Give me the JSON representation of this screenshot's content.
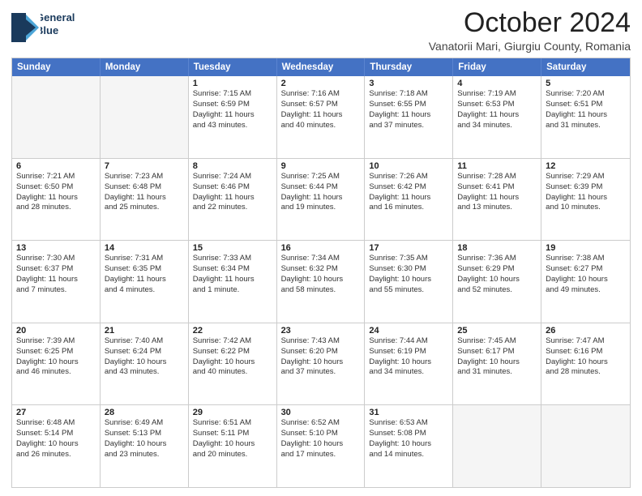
{
  "header": {
    "logo_line1": "General",
    "logo_line2": "Blue",
    "month": "October 2024",
    "location": "Vanatorii Mari, Giurgiu County, Romania"
  },
  "days_of_week": [
    "Sunday",
    "Monday",
    "Tuesday",
    "Wednesday",
    "Thursday",
    "Friday",
    "Saturday"
  ],
  "weeks": [
    [
      {
        "day": "",
        "lines": []
      },
      {
        "day": "",
        "lines": []
      },
      {
        "day": "1",
        "lines": [
          "Sunrise: 7:15 AM",
          "Sunset: 6:59 PM",
          "Daylight: 11 hours",
          "and 43 minutes."
        ]
      },
      {
        "day": "2",
        "lines": [
          "Sunrise: 7:16 AM",
          "Sunset: 6:57 PM",
          "Daylight: 11 hours",
          "and 40 minutes."
        ]
      },
      {
        "day": "3",
        "lines": [
          "Sunrise: 7:18 AM",
          "Sunset: 6:55 PM",
          "Daylight: 11 hours",
          "and 37 minutes."
        ]
      },
      {
        "day": "4",
        "lines": [
          "Sunrise: 7:19 AM",
          "Sunset: 6:53 PM",
          "Daylight: 11 hours",
          "and 34 minutes."
        ]
      },
      {
        "day": "5",
        "lines": [
          "Sunrise: 7:20 AM",
          "Sunset: 6:51 PM",
          "Daylight: 11 hours",
          "and 31 minutes."
        ]
      }
    ],
    [
      {
        "day": "6",
        "lines": [
          "Sunrise: 7:21 AM",
          "Sunset: 6:50 PM",
          "Daylight: 11 hours",
          "and 28 minutes."
        ]
      },
      {
        "day": "7",
        "lines": [
          "Sunrise: 7:23 AM",
          "Sunset: 6:48 PM",
          "Daylight: 11 hours",
          "and 25 minutes."
        ]
      },
      {
        "day": "8",
        "lines": [
          "Sunrise: 7:24 AM",
          "Sunset: 6:46 PM",
          "Daylight: 11 hours",
          "and 22 minutes."
        ]
      },
      {
        "day": "9",
        "lines": [
          "Sunrise: 7:25 AM",
          "Sunset: 6:44 PM",
          "Daylight: 11 hours",
          "and 19 minutes."
        ]
      },
      {
        "day": "10",
        "lines": [
          "Sunrise: 7:26 AM",
          "Sunset: 6:42 PM",
          "Daylight: 11 hours",
          "and 16 minutes."
        ]
      },
      {
        "day": "11",
        "lines": [
          "Sunrise: 7:28 AM",
          "Sunset: 6:41 PM",
          "Daylight: 11 hours",
          "and 13 minutes."
        ]
      },
      {
        "day": "12",
        "lines": [
          "Sunrise: 7:29 AM",
          "Sunset: 6:39 PM",
          "Daylight: 11 hours",
          "and 10 minutes."
        ]
      }
    ],
    [
      {
        "day": "13",
        "lines": [
          "Sunrise: 7:30 AM",
          "Sunset: 6:37 PM",
          "Daylight: 11 hours",
          "and 7 minutes."
        ]
      },
      {
        "day": "14",
        "lines": [
          "Sunrise: 7:31 AM",
          "Sunset: 6:35 PM",
          "Daylight: 11 hours",
          "and 4 minutes."
        ]
      },
      {
        "day": "15",
        "lines": [
          "Sunrise: 7:33 AM",
          "Sunset: 6:34 PM",
          "Daylight: 11 hours",
          "and 1 minute."
        ]
      },
      {
        "day": "16",
        "lines": [
          "Sunrise: 7:34 AM",
          "Sunset: 6:32 PM",
          "Daylight: 10 hours",
          "and 58 minutes."
        ]
      },
      {
        "day": "17",
        "lines": [
          "Sunrise: 7:35 AM",
          "Sunset: 6:30 PM",
          "Daylight: 10 hours",
          "and 55 minutes."
        ]
      },
      {
        "day": "18",
        "lines": [
          "Sunrise: 7:36 AM",
          "Sunset: 6:29 PM",
          "Daylight: 10 hours",
          "and 52 minutes."
        ]
      },
      {
        "day": "19",
        "lines": [
          "Sunrise: 7:38 AM",
          "Sunset: 6:27 PM",
          "Daylight: 10 hours",
          "and 49 minutes."
        ]
      }
    ],
    [
      {
        "day": "20",
        "lines": [
          "Sunrise: 7:39 AM",
          "Sunset: 6:25 PM",
          "Daylight: 10 hours",
          "and 46 minutes."
        ]
      },
      {
        "day": "21",
        "lines": [
          "Sunrise: 7:40 AM",
          "Sunset: 6:24 PM",
          "Daylight: 10 hours",
          "and 43 minutes."
        ]
      },
      {
        "day": "22",
        "lines": [
          "Sunrise: 7:42 AM",
          "Sunset: 6:22 PM",
          "Daylight: 10 hours",
          "and 40 minutes."
        ]
      },
      {
        "day": "23",
        "lines": [
          "Sunrise: 7:43 AM",
          "Sunset: 6:20 PM",
          "Daylight: 10 hours",
          "and 37 minutes."
        ]
      },
      {
        "day": "24",
        "lines": [
          "Sunrise: 7:44 AM",
          "Sunset: 6:19 PM",
          "Daylight: 10 hours",
          "and 34 minutes."
        ]
      },
      {
        "day": "25",
        "lines": [
          "Sunrise: 7:45 AM",
          "Sunset: 6:17 PM",
          "Daylight: 10 hours",
          "and 31 minutes."
        ]
      },
      {
        "day": "26",
        "lines": [
          "Sunrise: 7:47 AM",
          "Sunset: 6:16 PM",
          "Daylight: 10 hours",
          "and 28 minutes."
        ]
      }
    ],
    [
      {
        "day": "27",
        "lines": [
          "Sunrise: 6:48 AM",
          "Sunset: 5:14 PM",
          "Daylight: 10 hours",
          "and 26 minutes."
        ]
      },
      {
        "day": "28",
        "lines": [
          "Sunrise: 6:49 AM",
          "Sunset: 5:13 PM",
          "Daylight: 10 hours",
          "and 23 minutes."
        ]
      },
      {
        "day": "29",
        "lines": [
          "Sunrise: 6:51 AM",
          "Sunset: 5:11 PM",
          "Daylight: 10 hours",
          "and 20 minutes."
        ]
      },
      {
        "day": "30",
        "lines": [
          "Sunrise: 6:52 AM",
          "Sunset: 5:10 PM",
          "Daylight: 10 hours",
          "and 17 minutes."
        ]
      },
      {
        "day": "31",
        "lines": [
          "Sunrise: 6:53 AM",
          "Sunset: 5:08 PM",
          "Daylight: 10 hours",
          "and 14 minutes."
        ]
      },
      {
        "day": "",
        "lines": []
      },
      {
        "day": "",
        "lines": []
      }
    ]
  ]
}
